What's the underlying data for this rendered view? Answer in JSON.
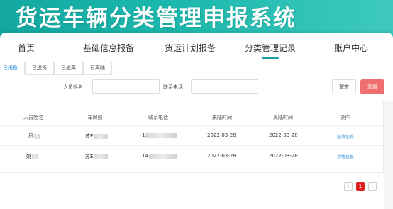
{
  "app": {
    "title": "货运车辆分类管理申报系统"
  },
  "nav": {
    "items": [
      "首页",
      "基础信息报备",
      "货运计划报备",
      "分类管理记录",
      "账户中心"
    ],
    "active_index": 3
  },
  "subtabs": {
    "items": [
      "已报备",
      "已送货",
      "已撤离",
      "已离陆"
    ],
    "active_index": 0
  },
  "search": {
    "name_label": "人员姓名:",
    "name_value": "",
    "phone_label": "联系电话:",
    "phone_value": "",
    "search_button": "搜索",
    "reset_button": "重置"
  },
  "table": {
    "headers": [
      "人员姓名",
      "车牌照",
      "联系电话",
      "来陆时间",
      "离陆时间",
      "操作"
    ],
    "rows": [
      {
        "name": "凤",
        "plate": "苏E",
        "phone": "1",
        "arrive": "2022-03-28",
        "leave": "2022-03-28",
        "action": "送货信息"
      },
      {
        "name": "姚",
        "plate": "苏E",
        "phone": "14",
        "arrive": "2022-03-28",
        "leave": "2022-03-28",
        "action": "送货信息"
      }
    ]
  },
  "pagination": {
    "prev": "‹",
    "current": "1",
    "next": "›"
  },
  "colors": {
    "banner": "#1cb8ad",
    "accent": "#1e9fa3",
    "link": "#2a8fd8",
    "reset": "#ef6f6f",
    "page_active": "#e02020"
  }
}
